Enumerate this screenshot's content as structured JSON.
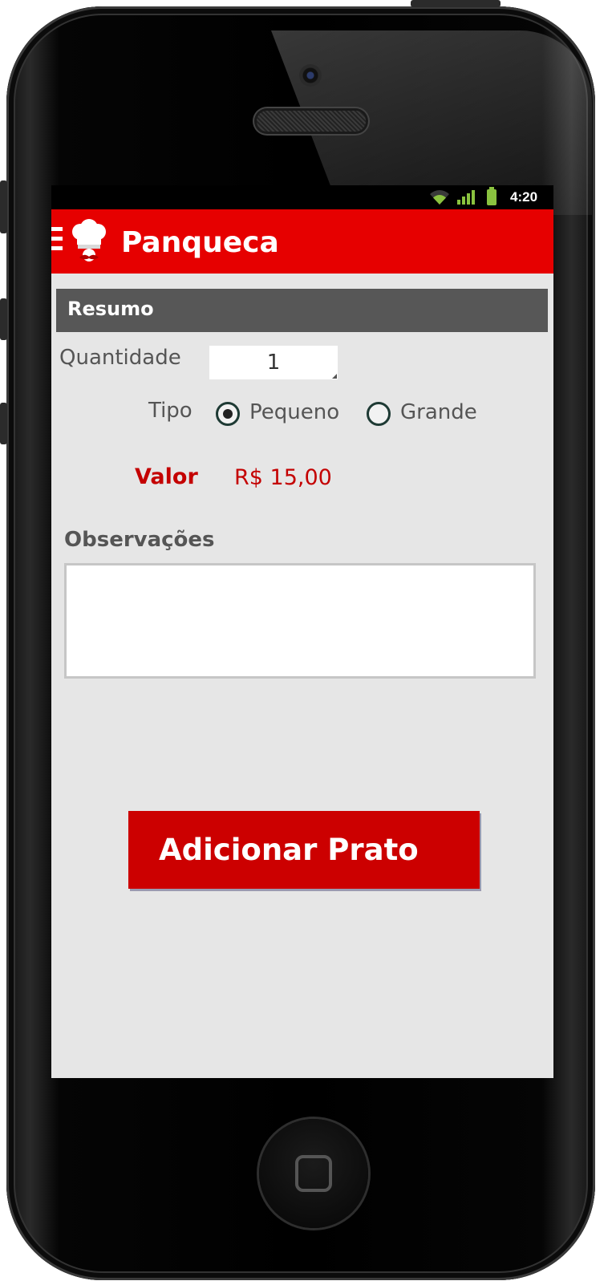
{
  "status_bar": {
    "time": "4:20",
    "wifi_icon": "wifi-icon",
    "signal_icon": "signal-icon",
    "battery_icon": "battery-icon"
  },
  "action_bar": {
    "title": "Panqueca",
    "menu_icon": "menu-icon",
    "logo_icon": "chef-hat-icon",
    "color": "#e60000"
  },
  "summary": {
    "title": "Resumo"
  },
  "quantity": {
    "label": "Quantidade",
    "value": "1"
  },
  "type": {
    "label": "Tipo",
    "options": [
      {
        "label": "Pequeno",
        "checked": true
      },
      {
        "label": "Grande",
        "checked": false
      }
    ]
  },
  "price": {
    "label": "Valor",
    "value": "R$ 15,00",
    "color": "#c40000"
  },
  "notes": {
    "label": "Observações",
    "value": ""
  },
  "add_button": {
    "label": "Adicionar Prato",
    "color": "#cc0000"
  }
}
